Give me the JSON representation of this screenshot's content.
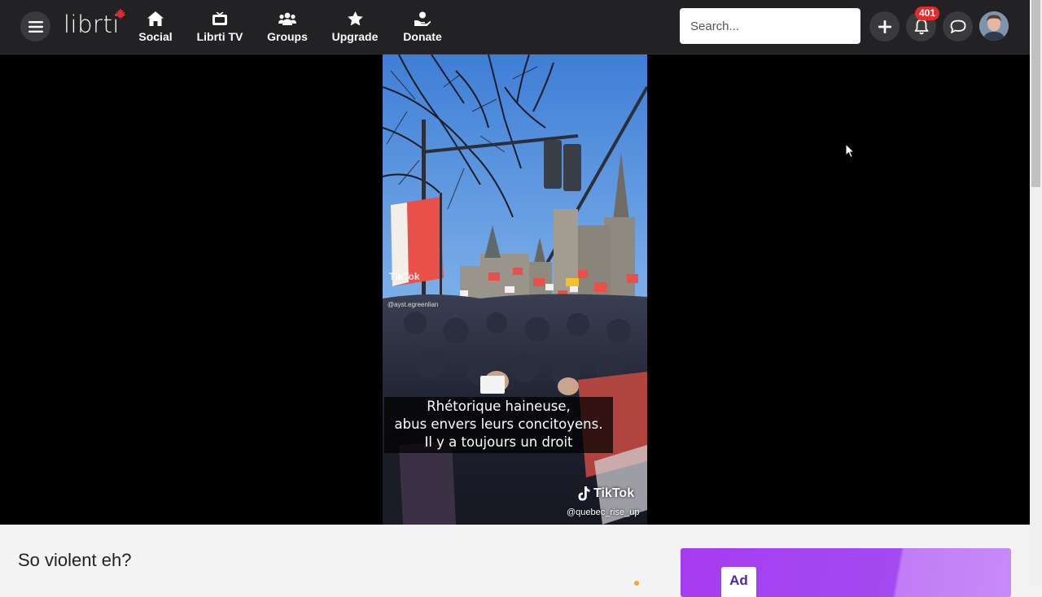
{
  "header": {
    "logo_text": "librti",
    "nav": [
      {
        "label": "Social",
        "icon": "home-icon"
      },
      {
        "label": "Librti TV",
        "icon": "tv-icon"
      },
      {
        "label": "Groups",
        "icon": "users-icon"
      },
      {
        "label": "Upgrade",
        "icon": "star-icon"
      },
      {
        "label": "Donate",
        "icon": "donate-icon"
      }
    ],
    "search_placeholder": "Search...",
    "notification_count": "401",
    "accent_color": "#e32b2b"
  },
  "video": {
    "subtitle_lines": [
      "Rhétorique haineuse,",
      "abus envers leurs concitoyens.",
      "Il y a toujours un droit"
    ],
    "watermark": "TikTok",
    "watermark_handle": "@quebec_rise_up",
    "watermark_small": "TikTok",
    "watermark_small_handle": "@ayst.egreenlian"
  },
  "post": {
    "title": "So violent eh?"
  },
  "ad": {
    "label": "Ad"
  }
}
